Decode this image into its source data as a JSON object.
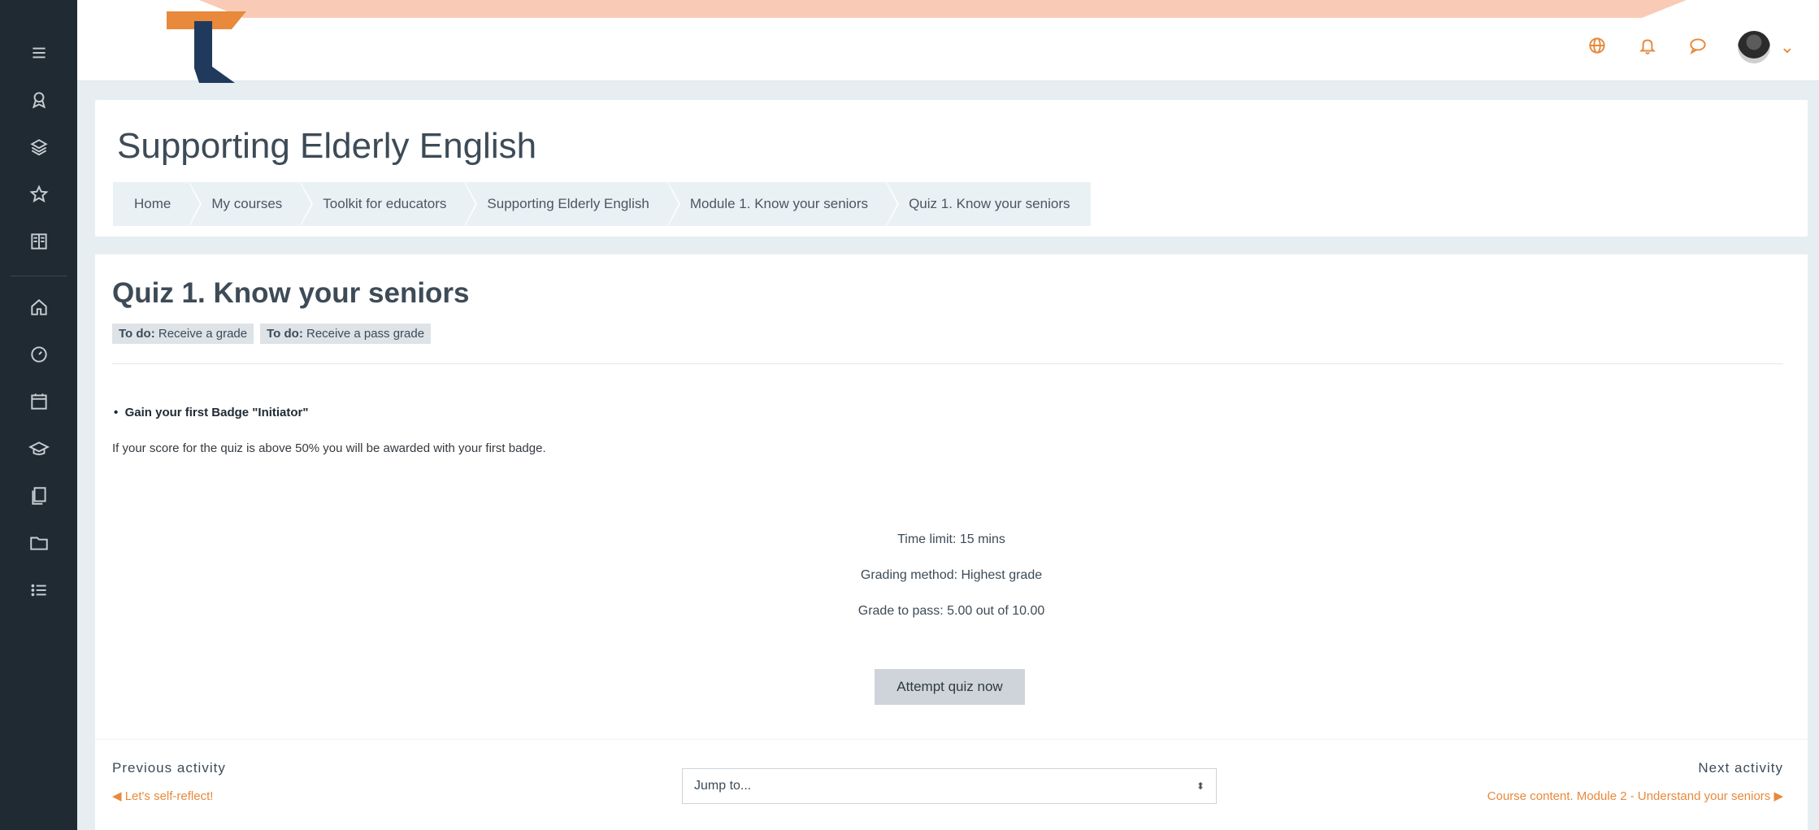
{
  "sidebar": {
    "items": [
      {
        "name": "menu-icon"
      },
      {
        "name": "badge-icon"
      },
      {
        "name": "layers-icon"
      },
      {
        "name": "star-icon"
      },
      {
        "name": "book-icon"
      },
      {
        "name": "home-icon"
      },
      {
        "name": "dashboard-icon"
      },
      {
        "name": "calendar-icon"
      },
      {
        "name": "graduation-cap-icon"
      },
      {
        "name": "files-icon"
      },
      {
        "name": "folder-icon"
      },
      {
        "name": "list-icon"
      }
    ]
  },
  "navbar": {
    "icons": [
      "globe-icon",
      "bell-icon",
      "chat-icon",
      "avatar",
      "chevron-down-icon"
    ],
    "accent": "#e8893c"
  },
  "header": {
    "title": "Supporting Elderly English",
    "breadcrumb": [
      "Home",
      "My courses",
      "Toolkit for educators",
      "Supporting Elderly English",
      "Module 1. Know your seniors",
      "Quiz 1. Know your seniors"
    ]
  },
  "quiz": {
    "title": "Quiz 1. Know your seniors",
    "completion": [
      {
        "label": "To do:",
        "text": "Receive a grade"
      },
      {
        "label": "To do:",
        "text": "Receive a pass grade"
      }
    ],
    "bullet": "Gain your first Badge \"Initiator\"",
    "intro": "If your score for the quiz is above 50% you will be awarded with your first badge.",
    "time_limit": "Time limit: 15 mins",
    "grading_method": "Grading method: Highest grade",
    "grade_to_pass": "Grade to pass: 5.00 out of 10.00",
    "attempt_button": "Attempt quiz now"
  },
  "activity_nav": {
    "previous_label": "Previous activity",
    "previous_link": "◀ Let's self-reflect!",
    "jump_placeholder": "Jump to...",
    "next_label": "Next activity",
    "next_link": "Course content. Module 2 - Understand your seniors ▶"
  },
  "colors": {
    "sidebar_bg": "#1f2a33",
    "page_bg": "#e6eef2",
    "accent": "#e8893c",
    "logo_blue": "#1f3a5c"
  }
}
